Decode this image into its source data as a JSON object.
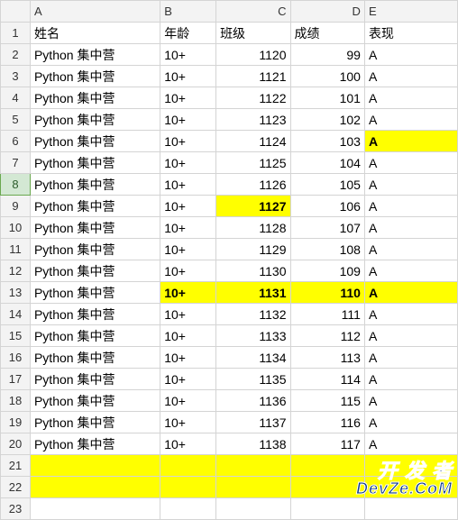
{
  "columns": [
    "A",
    "B",
    "C",
    "D",
    "E"
  ],
  "headers": {
    "A": "姓名",
    "B": "年龄",
    "C": "班级",
    "D": "成绩",
    "E": "表现"
  },
  "selectedRowHeader": 8,
  "rows": [
    {
      "n": 1,
      "cells": {
        "A": "姓名",
        "B": "年龄",
        "C": "班级",
        "D": "成绩",
        "E": "表现"
      },
      "isHeaderRow": true
    },
    {
      "n": 2,
      "cells": {
        "A": "Python 集中营",
        "B": "10+",
        "C": "1120",
        "D": "99",
        "E": "A"
      }
    },
    {
      "n": 3,
      "cells": {
        "A": "Python 集中营",
        "B": "10+",
        "C": "1121",
        "D": "100",
        "E": "A"
      }
    },
    {
      "n": 4,
      "cells": {
        "A": "Python 集中营",
        "B": "10+",
        "C": "1122",
        "D": "101",
        "E": "A"
      }
    },
    {
      "n": 5,
      "cells": {
        "A": "Python 集中营",
        "B": "10+",
        "C": "1123",
        "D": "102",
        "E": "A"
      }
    },
    {
      "n": 6,
      "cells": {
        "A": "Python 集中营",
        "B": "10+",
        "C": "1124",
        "D": "103",
        "E": "A"
      },
      "highlight": [
        "E"
      ],
      "bold": [
        "E"
      ]
    },
    {
      "n": 7,
      "cells": {
        "A": "Python 集中营",
        "B": "10+",
        "C": "1125",
        "D": "104",
        "E": "A"
      }
    },
    {
      "n": 8,
      "cells": {
        "A": "Python 集中营",
        "B": "10+",
        "C": "1126",
        "D": "105",
        "E": "A"
      }
    },
    {
      "n": 9,
      "cells": {
        "A": "Python 集中营",
        "B": "10+",
        "C": "1127",
        "D": "106",
        "E": "A"
      },
      "highlight": [
        "C"
      ],
      "bold": [
        "C"
      ]
    },
    {
      "n": 10,
      "cells": {
        "A": "Python 集中营",
        "B": "10+",
        "C": "1128",
        "D": "107",
        "E": "A"
      }
    },
    {
      "n": 11,
      "cells": {
        "A": "Python 集中营",
        "B": "10+",
        "C": "1129",
        "D": "108",
        "E": "A"
      }
    },
    {
      "n": 12,
      "cells": {
        "A": "Python 集中营",
        "B": "10+",
        "C": "1130",
        "D": "109",
        "E": "A"
      }
    },
    {
      "n": 13,
      "cells": {
        "A": "Python 集中营",
        "B": "10+",
        "C": "1131",
        "D": "110",
        "E": "A"
      },
      "highlight": [
        "B",
        "C",
        "D",
        "E"
      ],
      "bold": [
        "B",
        "C",
        "D",
        "E"
      ]
    },
    {
      "n": 14,
      "cells": {
        "A": "Python 集中营",
        "B": "10+",
        "C": "1132",
        "D": "111",
        "E": "A"
      }
    },
    {
      "n": 15,
      "cells": {
        "A": "Python 集中营",
        "B": "10+",
        "C": "1133",
        "D": "112",
        "E": "A"
      }
    },
    {
      "n": 16,
      "cells": {
        "A": "Python 集中营",
        "B": "10+",
        "C": "1134",
        "D": "113",
        "E": "A"
      }
    },
    {
      "n": 17,
      "cells": {
        "A": "Python 集中营",
        "B": "10+",
        "C": "1135",
        "D": "114",
        "E": "A"
      }
    },
    {
      "n": 18,
      "cells": {
        "A": "Python 集中营",
        "B": "10+",
        "C": "1136",
        "D": "115",
        "E": "A"
      }
    },
    {
      "n": 19,
      "cells": {
        "A": "Python 集中营",
        "B": "10+",
        "C": "1137",
        "D": "116",
        "E": "A"
      }
    },
    {
      "n": 20,
      "cells": {
        "A": "Python 集中营",
        "B": "10+",
        "C": "1138",
        "D": "117",
        "E": "A"
      }
    },
    {
      "n": 21,
      "cells": {
        "A": "",
        "B": "",
        "C": "",
        "D": "",
        "E": ""
      },
      "highlight": [
        "A",
        "B",
        "C",
        "D",
        "E"
      ]
    },
    {
      "n": 22,
      "cells": {
        "A": "",
        "B": "",
        "C": "",
        "D": "",
        "E": ""
      },
      "highlight": [
        "A",
        "B",
        "C",
        "D",
        "E"
      ]
    },
    {
      "n": 23,
      "cells": {
        "A": "",
        "B": "",
        "C": "",
        "D": "",
        "E": ""
      }
    }
  ],
  "watermark": {
    "line1": "开 发 者",
    "line2": "DevZe.CoM"
  }
}
